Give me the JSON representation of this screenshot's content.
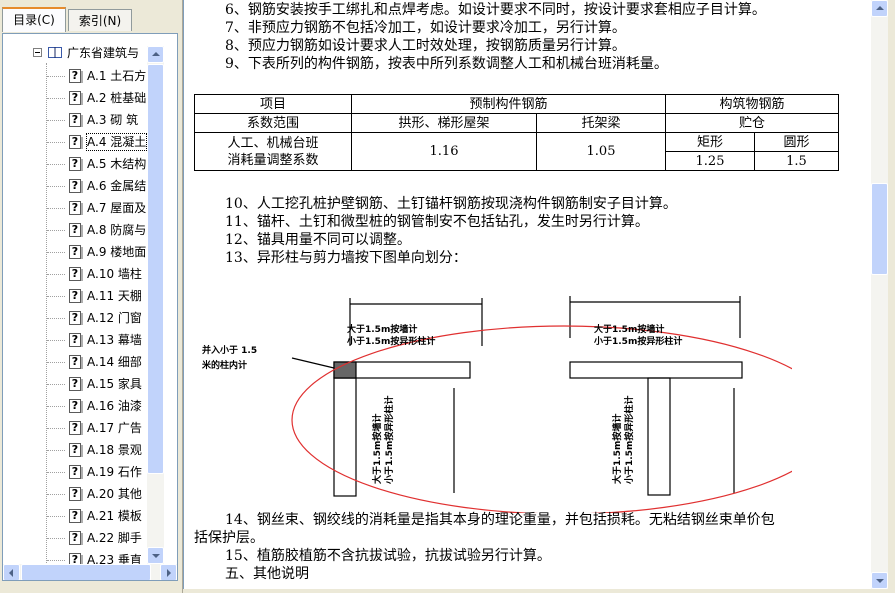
{
  "left_pane": {
    "tabs": [
      {
        "label": "目录(C)",
        "active": true
      },
      {
        "label": "索引(N)",
        "active": false
      }
    ],
    "root": {
      "label": "广东省建筑与"
    },
    "items": [
      {
        "label": "A.1  土石方"
      },
      {
        "label": "A.2  桩基础"
      },
      {
        "label": "A.3  砌  筑"
      },
      {
        "label": "A.4  混凝土",
        "selected": true
      },
      {
        "label": "A.5  木结构"
      },
      {
        "label": "A.6  金属结"
      },
      {
        "label": "A.7  屋面及"
      },
      {
        "label": "A.8  防腐与"
      },
      {
        "label": "A.9  楼地面"
      },
      {
        "label": "A.10  墙柱"
      },
      {
        "label": "A.11  天棚"
      },
      {
        "label": "A.12  门窗"
      },
      {
        "label": "A.13  幕墙"
      },
      {
        "label": "A.14  细部"
      },
      {
        "label": "A.15  家具"
      },
      {
        "label": "A.16  油漆"
      },
      {
        "label": "A.17  广告"
      },
      {
        "label": "A.18  景观"
      },
      {
        "label": "A.19  石作"
      },
      {
        "label": "A.20  其他"
      },
      {
        "label": "A.21  模板"
      },
      {
        "label": "A.22  脚手"
      },
      {
        "label": "A.23  垂直"
      }
    ]
  },
  "document": {
    "lines_top": [
      "6、钢筋安装按手工绑扎和点焊考虑。如设计要求不同时，按设计要求套相应子目计算。",
      "7、非预应力钢筋不包括冷加工，如设计要求冷加工，另行计算。",
      "8、预应力钢筋如设计要求人工时效处理，按钢筋质量另行计算。",
      "9、下表所列的构件钢筋，按表中所列系数调整人工和机械台班消耗量。"
    ],
    "table": {
      "col_project": "项目",
      "col_prefab": "预制构件钢筋",
      "col_structure": "构筑物钢筋",
      "row_scope": "系数范围",
      "truss": "拱形、梯形屋架",
      "beam": "托架梁",
      "silo": "贮仓",
      "rect": "矩形",
      "round": "圆形",
      "row_label_1": "人工、机械台班",
      "row_label_2": "消耗量调整系数",
      "v_truss": "1.16",
      "v_beam": "1.05",
      "v_rect": "1.25",
      "v_round": "1.5"
    },
    "lines_mid": [
      "10、人工挖孔桩护壁钢筋、土钉锚杆钢筋按现浇构件钢筋制安子目计算。",
      "11、锚杆、土钉和微型桩的钢管制安不包括钻孔，发生时另行计算。",
      "12、锚具用量不同可以调整。",
      "13、异形柱与剪力墙按下图单向划分："
    ],
    "diagram": {
      "left_note_1": "并入小于 1.5",
      "left_note_2": "米的柱内计",
      "top1_a": "大于1.5m按墙计",
      "top1_b": "小于1.5m按异形柱计",
      "top2_a": "大于1.5m按墙计",
      "top2_b": "小于1.5m按异形柱计",
      "vert1": "大于1.5m按墙计",
      "vert2": "小于1.5m按异形柱计",
      "vert3": "大于1.5m按墙计",
      "vert4": "小于1.5m按异形柱计",
      "circle_color": "#e03030"
    },
    "lines_bottom": [
      "14、钢丝束、钢绞线的消耗量是指其本身的理论重量，并包括损耗。无粘结钢丝束单价包",
      "括保护层。",
      "15、植筋胶植筋不含抗拔试验，抗拔试验另行计算。",
      "五、其他说明"
    ]
  }
}
